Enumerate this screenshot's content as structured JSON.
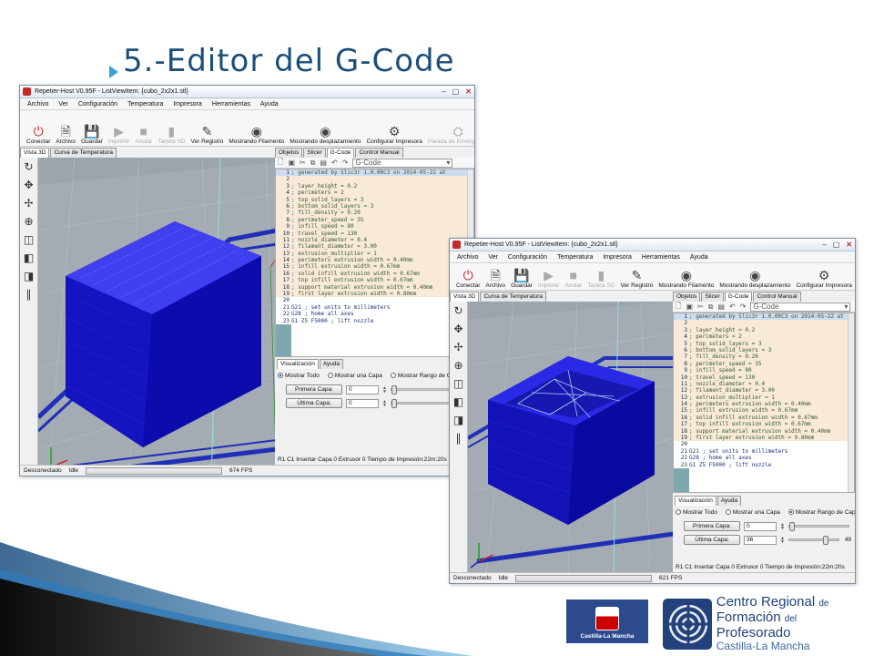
{
  "slide": {
    "title": "5.-Editor del G-Code"
  },
  "app": {
    "window_title": "Repetier-Host V0.95F - ListViewItem: {cubo_2x2x1.stl}",
    "menu": [
      "Archivo",
      "Ver",
      "Configuración",
      "Temperatura",
      "Impresora",
      "Herramientas",
      "Ayuda"
    ],
    "toolbar": [
      {
        "label": "Conectar",
        "icon": "power-icon"
      },
      {
        "label": "Archivo",
        "icon": "file-icon"
      },
      {
        "label": "Guardar",
        "icon": "save-icon"
      },
      {
        "label": "Imprimir",
        "icon": "play-icon",
        "disabled": true
      },
      {
        "label": "Anular",
        "icon": "stop-icon",
        "disabled": true
      },
      {
        "label": "Tarjeta SD",
        "icon": "sd-card-icon",
        "disabled": true
      },
      {
        "label": "Ver Registro",
        "icon": "pencil-icon"
      },
      {
        "label": "Mostrando Filamento",
        "icon": "eye-icon"
      },
      {
        "label": "Mostrando desplazamiento",
        "icon": "eye-icon"
      },
      {
        "label": "Configurar Impresora",
        "icon": "gears-icon"
      },
      {
        "label": "Parada de Emergencia",
        "icon": "emergency-icon",
        "disabled": true
      }
    ],
    "left_tabs": [
      "Vista 3D",
      "Curva de Temperatura"
    ],
    "right_tabs": [
      "Objetos",
      "Slicer",
      "G-Code",
      "Control Manual"
    ],
    "editor_select": "G-Code",
    "code_lines": [
      {
        "n": "1",
        "t": "; generated by Slic3r 1.0.0RC3 on 2014-05-22 at",
        "k": "c"
      },
      {
        "n": "2",
        "t": "",
        "k": "c"
      },
      {
        "n": "3",
        "t": "; layer_height = 0.2",
        "k": "c"
      },
      {
        "n": "4",
        "t": "; perimeters = 2",
        "k": "c"
      },
      {
        "n": "5",
        "t": "; top_solid_layers = 3",
        "k": "c"
      },
      {
        "n": "6",
        "t": "; bottom_solid_layers = 3",
        "k": "c"
      },
      {
        "n": "7",
        "t": "; fill_density = 0.20",
        "k": "c"
      },
      {
        "n": "8",
        "t": "; perimeter_speed = 35",
        "k": "c"
      },
      {
        "n": "9",
        "t": "; infill_speed = 80",
        "k": "c"
      },
      {
        "n": "10",
        "t": "; travel_speed = 130",
        "k": "c"
      },
      {
        "n": "11",
        "t": "; nozzle_diameter = 0.4",
        "k": "c"
      },
      {
        "n": "12",
        "t": "; filament_diameter = 3.00",
        "k": "c"
      },
      {
        "n": "13",
        "t": "; extrusion_multiplier = 1",
        "k": "c"
      },
      {
        "n": "14",
        "t": "; perimeters extrusion width = 0.40mm",
        "k": "c"
      },
      {
        "n": "15",
        "t": "; infill extrusion width = 0.67mm",
        "k": "c"
      },
      {
        "n": "16",
        "t": "; solid infill extrusion width = 0.67mm",
        "k": "c"
      },
      {
        "n": "17",
        "t": "; top infill extrusion width = 0.67mm",
        "k": "c"
      },
      {
        "n": "18",
        "t": "; support material extrusion width = 0.40mm",
        "k": "c"
      },
      {
        "n": "19",
        "t": "; first layer extrusion width = 0.80mm",
        "k": "c"
      },
      {
        "n": "20",
        "t": "",
        "k": "g"
      },
      {
        "n": "21",
        "t": "G21 ; set units to millimeters",
        "k": "g"
      },
      {
        "n": "22",
        "t": "G28 ; home all axes",
        "k": "g"
      },
      {
        "n": "23",
        "t": "G1 Z5 F5000 ; lift nozzle",
        "k": "g"
      }
    ],
    "vis_tabs": [
      "Visualización",
      "Ayuda"
    ],
    "radios": [
      "Mostrar Todo",
      "Mostrar una Capa",
      "Mostrar Rango de Capas"
    ],
    "first_layer_label": "Primera Capa:",
    "last_layer_label": "Última Capa:",
    "status_line": "R1  C1  Insertar  Capa 0  Extrusor 0  Tiempo de Impresión:22m:20s",
    "status_conn": "Desconectado",
    "status_idle": "Idle",
    "win1": {
      "first": "0",
      "last": "0",
      "fps": "674 FPS",
      "radio": 0
    },
    "win2": {
      "first": "0",
      "last": "36",
      "max": "49",
      "fps": "621 FPS",
      "radio": 2
    }
  },
  "logos": {
    "jccm": "Castilla-La Mancha",
    "crfp_line1": "Centro Regional",
    "crfp_de": "de",
    "crfp_line2a": "Formación",
    "crfp_del": "del",
    "crfp_line2b": "Profesorado",
    "crfp_line3": "Castilla-La Mancha"
  },
  "colors": {
    "title": "#1b4f7a",
    "model_blue": "#1a1ad8",
    "viewport_gray": "#9ca4ac"
  }
}
